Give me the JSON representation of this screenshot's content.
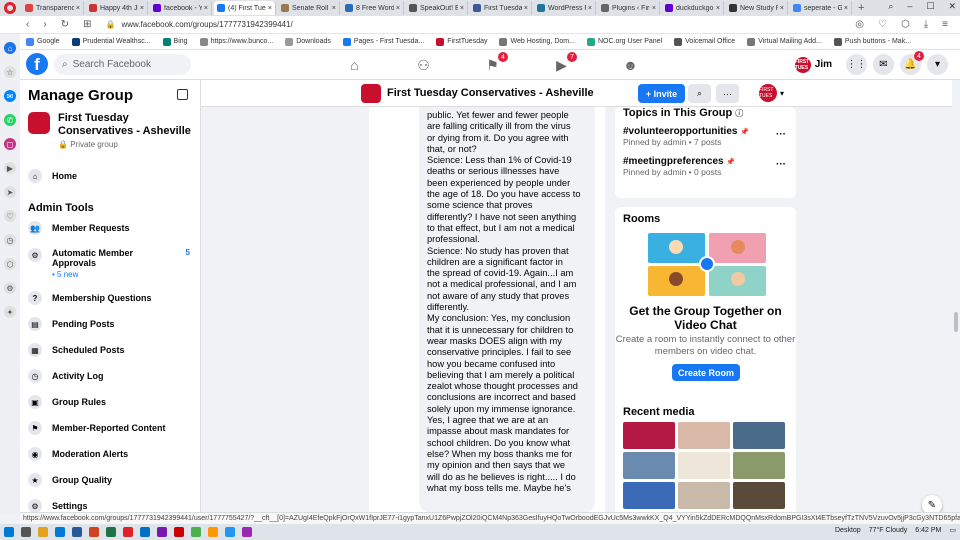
{
  "browser": {
    "tabs": [
      {
        "title": "Transparency",
        "color": "#d44"
      },
      {
        "title": "Happy 4th Ju",
        "color": "#c33"
      },
      {
        "title": "facebook - Ya",
        "color": "#6001d2"
      },
      {
        "title": "(4) First Tues",
        "color": "#1877f2",
        "active": true
      },
      {
        "title": "Senate Roll C",
        "color": "#9a7b4f"
      },
      {
        "title": "8 Free WordP",
        "color": "#2a6ebb"
      },
      {
        "title": "SpeakOut! Ent",
        "color": "#555"
      },
      {
        "title": "First Tuesday",
        "color": "#3b5998"
      },
      {
        "title": "WordPress Pr",
        "color": "#21759b"
      },
      {
        "title": "Plugins ‹ First",
        "color": "#666"
      },
      {
        "title": "duckduckgo.c",
        "color": "#6001d2"
      },
      {
        "title": "New Study Fi",
        "color": "#333"
      },
      {
        "title": "seperate - Go",
        "color": "#4285f4"
      }
    ],
    "url": "www.facebook.com/groups/1777731942399441/",
    "bookmarks": [
      {
        "label": "Google",
        "color": "#4285f4"
      },
      {
        "label": "Prudential Wealthsc...",
        "color": "#0a3d7a"
      },
      {
        "label": "Bing",
        "color": "#008373"
      },
      {
        "label": "https://www.bunco...",
        "color": "#888"
      },
      {
        "label": "Downloads",
        "color": "#999"
      },
      {
        "label": "Pages - First Tuesda...",
        "color": "#1877f2"
      },
      {
        "label": "FirstTuesday",
        "color": "#c8102e"
      },
      {
        "label": "Web Hosting, Dom...",
        "color": "#777"
      },
      {
        "label": "NOC.org User Panel",
        "color": "#2a8"
      },
      {
        "label": "Voicemail Office",
        "color": "#555"
      },
      {
        "label": "Virtual Mailing Add...",
        "color": "#777"
      },
      {
        "label": "Push buttons - Mak...",
        "color": "#555"
      }
    ],
    "status_url": "https://www.facebook.com/groups/1777731942399441/user/1777755427/?__cft__[0]=AZUgI4EfeQpkFjOrQxW1fIprJE77-i1gypTanxU1Z6PwpjZOl20iQCM4Np363GesIfuyHQoTwOrboodEGJvUc5Ms3wwkKX_Q4_VYYin5kZdDERcMDQQnMsxRdomBPGI3sXt4ETbseyfTzTNV5VzuvOv5jjP3cGy3NTD65pfa_w85D4RegWiipctNeQ0MN..."
  },
  "fb": {
    "search_placeholder": "Search Facebook",
    "nav_badges": {
      "groups": "4",
      "watch": "7"
    },
    "user_name": "Jim",
    "notif_badge": "4",
    "avatar_text": "FIRST TUES"
  },
  "manage": {
    "title": "Manage Group",
    "group_name": "First Tuesday Conservatives - Asheville",
    "privacy": "Private group",
    "home": "Home",
    "admin_tools": "Admin Tools",
    "items": [
      {
        "label": "Member Requests",
        "icon": "👥"
      },
      {
        "label": "Automatic Member Approvals",
        "icon": "⚙",
        "sub": "• 5 new",
        "count": "5"
      },
      {
        "label": "Membership Questions",
        "icon": "?"
      },
      {
        "label": "Pending Posts",
        "icon": "▤"
      },
      {
        "label": "Scheduled Posts",
        "icon": "▦"
      },
      {
        "label": "Activity Log",
        "icon": "◷"
      },
      {
        "label": "Group Rules",
        "icon": "▣"
      },
      {
        "label": "Member-Reported Content",
        "icon": "⚑"
      },
      {
        "label": "Moderation Alerts",
        "icon": "◉"
      },
      {
        "label": "Group Quality",
        "icon": "★"
      },
      {
        "label": "Settings",
        "icon": "⚙"
      }
    ]
  },
  "header": {
    "group_name": "First Tuesday Conservatives - Asheville",
    "invite": "+ Invite"
  },
  "comment": {
    "lines": [
      "public. Yet fewer and fewer people",
      "are falling critically ill from the virus",
      "or dying from it. Do you agree with",
      "that, or not?",
      "Science: Less than 1% of Covid-19",
      "deaths or serious illnesses have",
      "been experienced by people under",
      "the age of 18. Do you have access to",
      "some science that proves",
      "differently? I have not seen anything",
      "to that effect, but I am not a medical",
      "professional.",
      "Science: No study has proven that",
      "children are a significant factor in",
      "the spread of covid-19. Again...I am",
      "not a medical professional, and I am",
      "not aware of any study that proves",
      "differently.",
      "My conclusion: Yes, my conclusion",
      "that it is unnecessary for children to",
      "wear masks DOES align with my",
      "conservative principles. I fail to see",
      "how you became confused into",
      "believing that I am merely a political",
      "zealot whose thought processes and",
      "conclusions are incorrect and based",
      "solely upon my immense ignorance.",
      "Yes, I agree that we are at an",
      "impasse about mask mandates for",
      "school children. Do you know what",
      "else? When my boss thanks me for",
      "my opinion and then says that we",
      "will do as he believes is right..... I do",
      "what my boss tells me. Maybe he's"
    ]
  },
  "topics": {
    "title": "Topics in This Group",
    "items": [
      {
        "name": "#volunteeropportunities",
        "meta": "Pinned by admin • 7 posts"
      },
      {
        "name": "#meetingpreferences",
        "meta": "Pinned by admin • 0 posts"
      }
    ]
  },
  "rooms": {
    "title": "Rooms",
    "heading": "Get the Group Together on Video Chat",
    "body": "Create a room to instantly connect to other members on video chat.",
    "button": "Create Room"
  },
  "media": {
    "title": "Recent media",
    "thumbs": [
      "#b31942",
      "#d9b8a8",
      "#4a6a8a",
      "#6a8ab0",
      "#eee6d8",
      "#8a9a6a",
      "#3a6ab8",
      "#c9b9a9",
      "#5a4a3a"
    ]
  },
  "taskbar": {
    "desktop": "Desktop",
    "weather": "77°F  Cloudy",
    "time": "6:42 PM"
  }
}
